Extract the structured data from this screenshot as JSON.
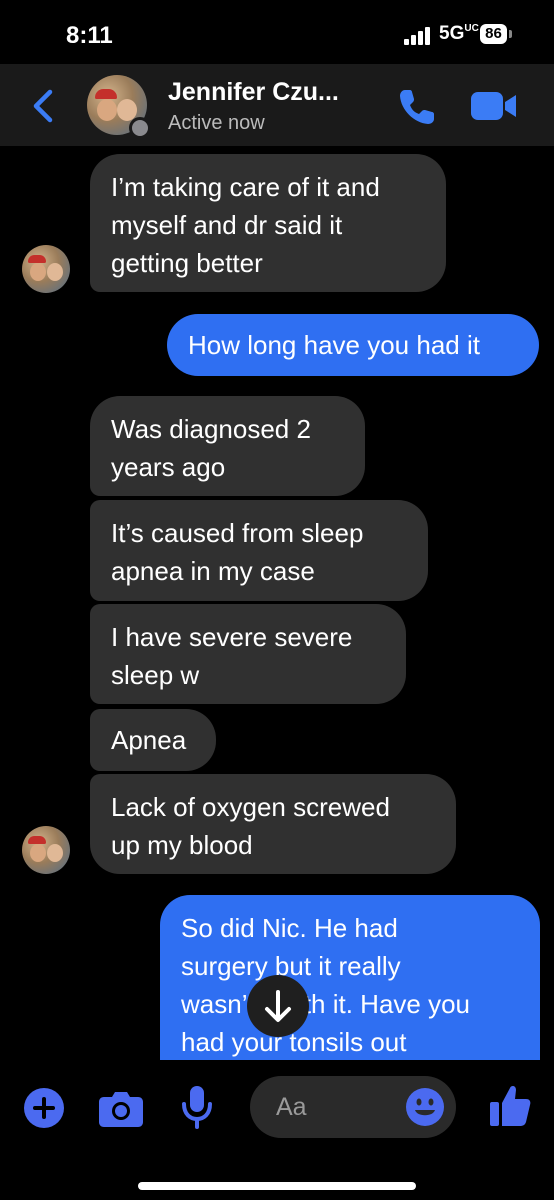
{
  "status_bar": {
    "time": "8:11",
    "network": "5G",
    "network_suffix": "UC",
    "battery": "86"
  },
  "header": {
    "contact_name": "Jennifer Czu...",
    "status": "Active now",
    "icons": [
      "back-icon",
      "phone-icon",
      "video-camera-icon"
    ]
  },
  "messages": [
    {
      "from": "contact",
      "text": "I’m taking care of it and\nmyself and dr said it\ngetting better"
    },
    {
      "from": "me",
      "text": "How long have you had it"
    },
    {
      "from": "contact",
      "text": "Was diagnosed 2\nyears ago"
    },
    {
      "from": "contact",
      "text": "It’s caused from sleep\napnea in my case"
    },
    {
      "from": "contact",
      "text": "I have severe severe\nsleep w"
    },
    {
      "from": "contact",
      "text": "Apnea"
    },
    {
      "from": "contact",
      "text": "Lack of oxygen screwed\nup my blood"
    },
    {
      "from": "me",
      "text": "So did Nic. He had\nsurgery but it really\nwasn’t worth it. Have you\nhad your tonsils out"
    }
  ],
  "composer": {
    "placeholder": "Aa",
    "icons": [
      "plus-icon",
      "camera-icon",
      "microphone-icon",
      "emoji-icon",
      "thumbs-up-icon"
    ]
  },
  "colors": {
    "outgoing_bubble": "#2f6ff2",
    "incoming_bubble": "#303030",
    "accent": "#3b7cf5"
  }
}
